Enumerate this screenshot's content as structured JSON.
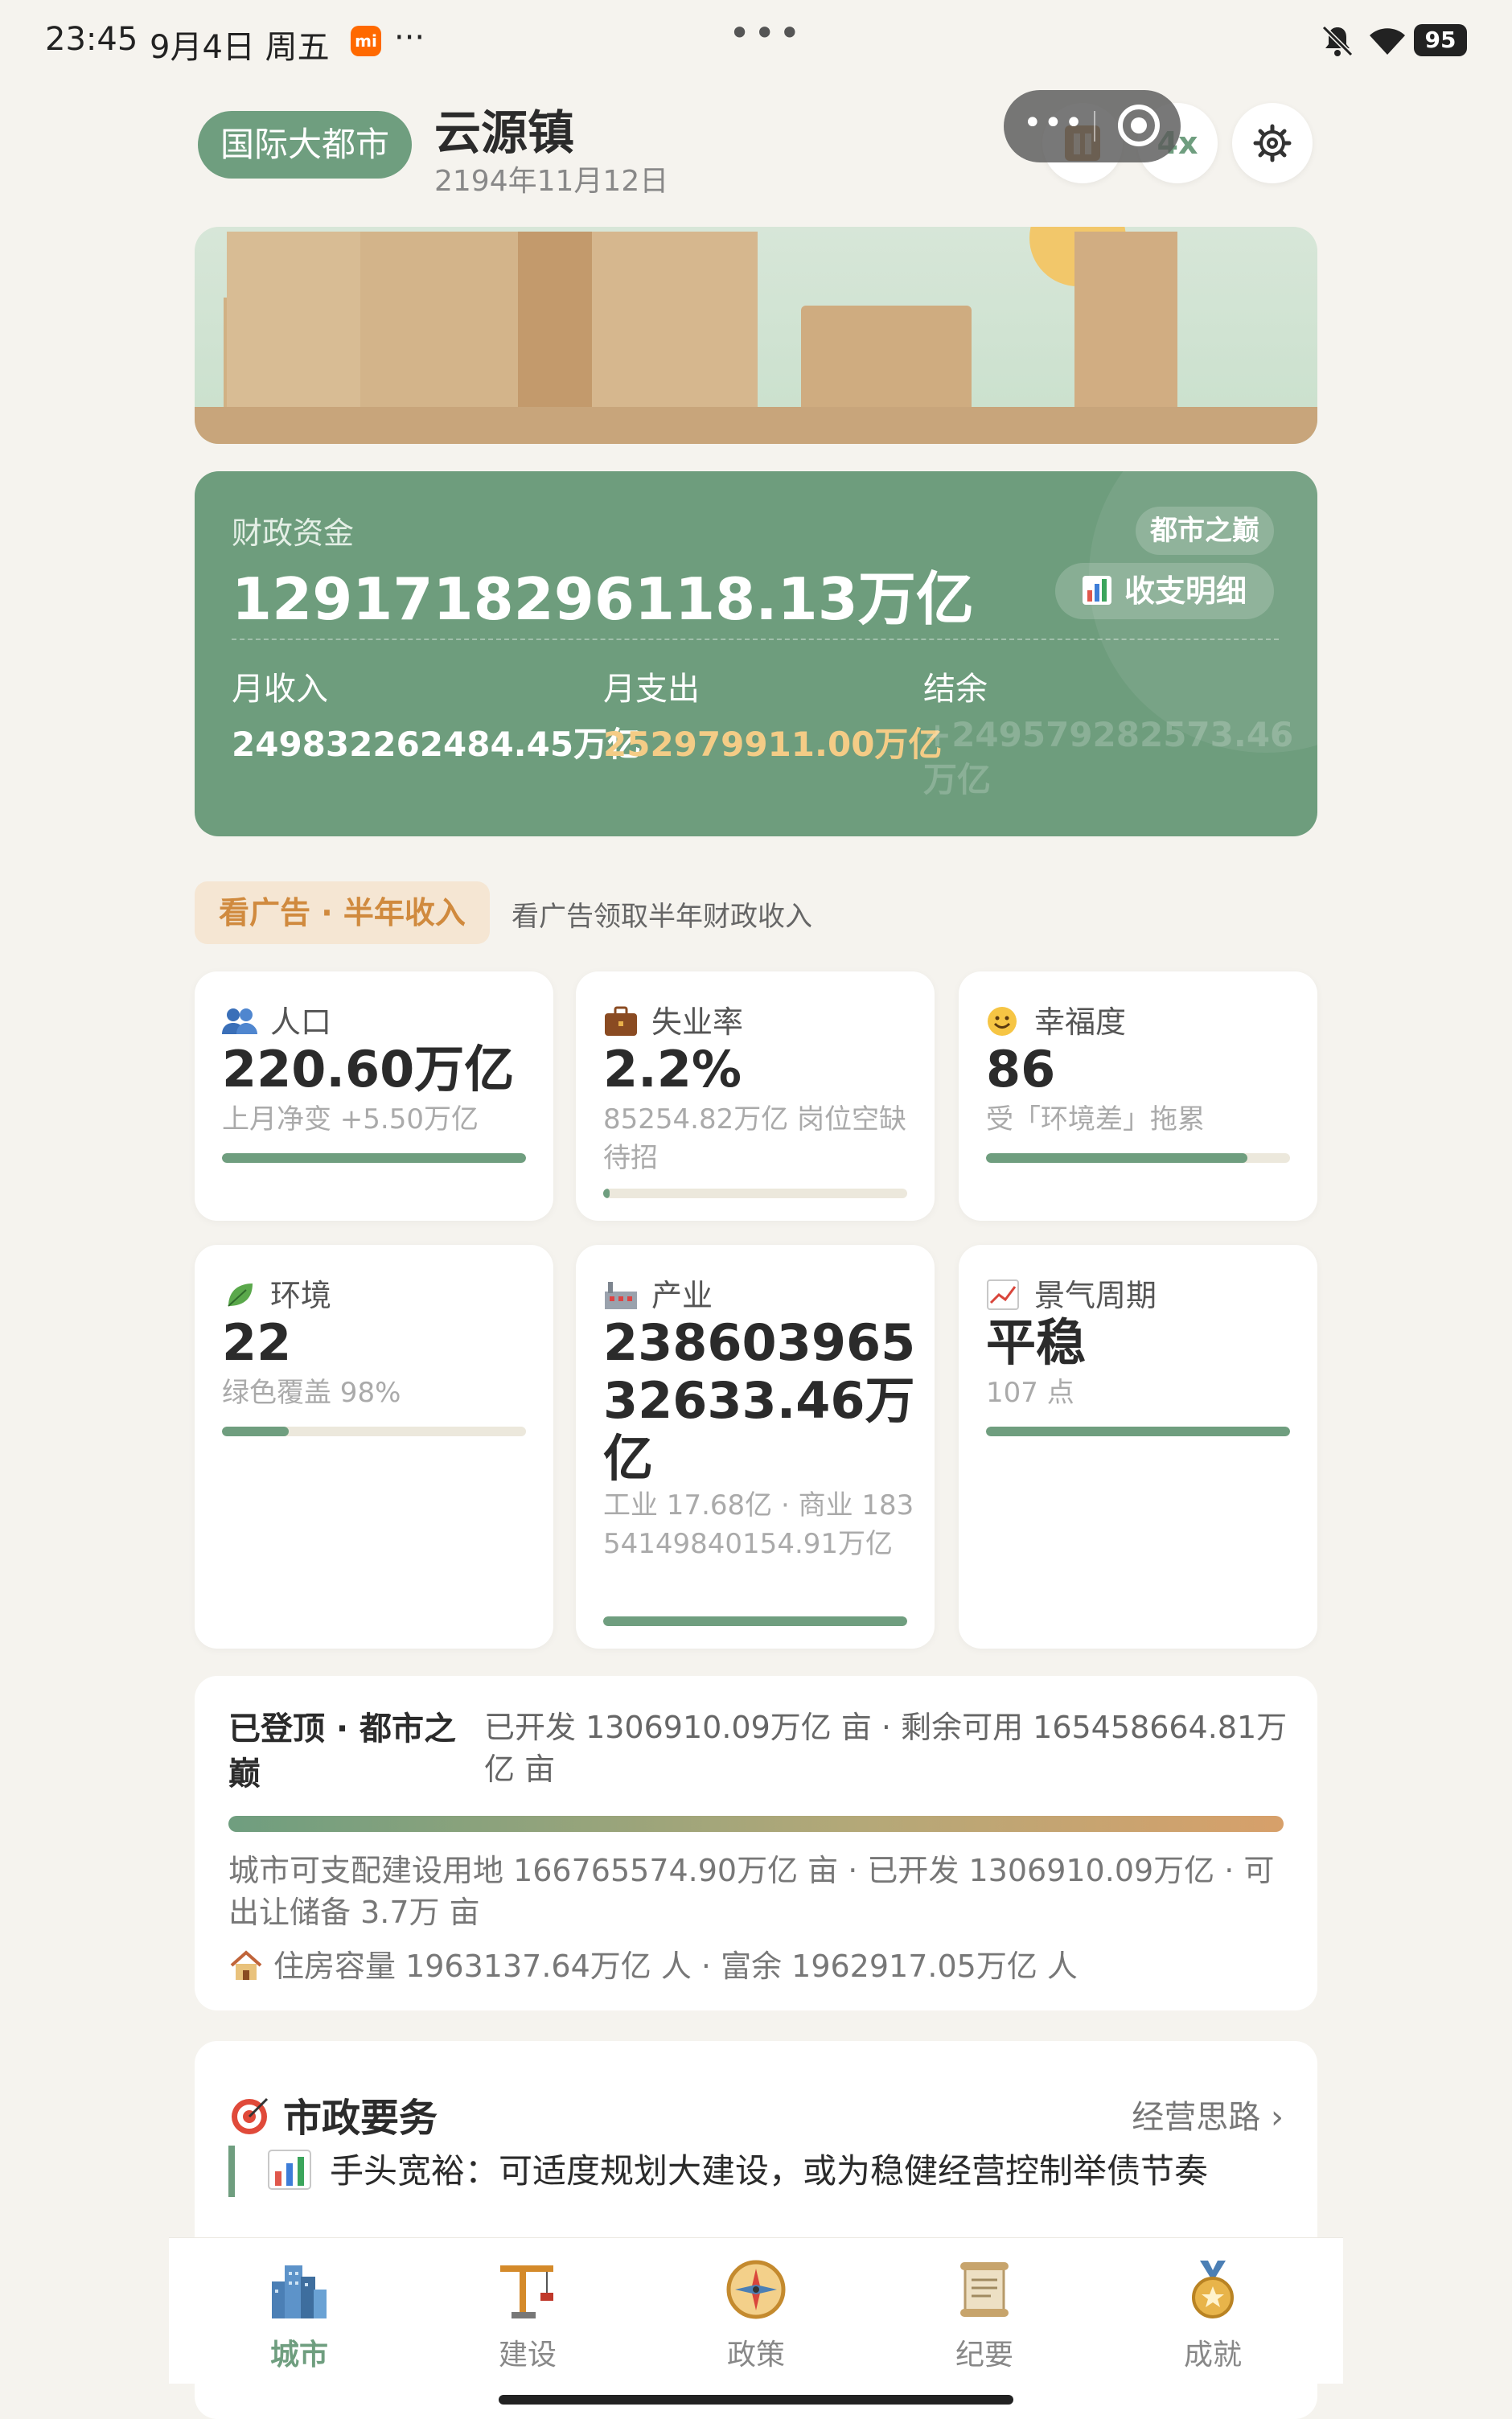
{
  "status_bar": {
    "time": "23:45",
    "date": "9月4日 周五",
    "battery": "95",
    "mi_label": "mi",
    "more_dots": "···",
    "center_dots": "•••"
  },
  "header": {
    "level": "国际大都市",
    "town": "云源镇",
    "date": "2194年11月12日",
    "speed": "4x"
  },
  "finance": {
    "label": "财政资金",
    "amount": "129171829611​8.13万亿",
    "badge": "都市之巅",
    "detail_button": "收支明细",
    "income_label": "月收入",
    "income": "249832262484.45万亿",
    "expense_label": "月支出",
    "expense": "252979911.00万亿",
    "balance_label": "结余",
    "balance": "+249579282573.46万亿"
  },
  "ad": {
    "button": "看广告 · 半年收入",
    "description": "看广告领取半年财政收入"
  },
  "stats": [
    {
      "title": "人口",
      "value": "220.60万亿",
      "sub": "上月净变 +5.50万亿",
      "progress": 1.0
    },
    {
      "title": "失业率",
      "value": "2.2%",
      "sub": "85254.82万亿 岗位空缺待招",
      "progress": 0.02
    },
    {
      "title": "幸福度",
      "value": "86",
      "sub": "受「环境差」拖累",
      "progress": 0.86
    },
    {
      "title": "环境",
      "value": "22",
      "sub": "绿色覆盖 98%",
      "progress": 0.22
    },
    {
      "title": "产业",
      "value": "23860396532633.46万亿",
      "sub": "工业 17.68亿 · 商业 18354149840154.91万亿",
      "progress": 1.0
    },
    {
      "title": "景气周期",
      "value": "平稳",
      "sub": "107 点",
      "progress": 1.0
    }
  ],
  "land": {
    "title": "已登顶 · 都市之巅",
    "developed": "已开发 1306910.09万亿 亩 · 剩余可用 165458664.81万亿 亩",
    "info": "城市可支配建设用地 166765574.90万亿 亩 · 已开发 1306910.09万亿 · 可出让储备 3.7万 亩",
    "housing": "住房容量 1963137.64万亿 人 · 富余 1962917.05万亿 人"
  },
  "civic": {
    "title": "市政要务",
    "link": "经营思路 ›",
    "item": "手头宽裕：可适度规划大建设，或为稳健经营控制举债节奏"
  },
  "tabs": [
    {
      "label": "城市",
      "icon": "city-icon"
    },
    {
      "label": "建设",
      "icon": "crane-icon"
    },
    {
      "label": "政策",
      "icon": "compass-icon"
    },
    {
      "label": "纪要",
      "icon": "scroll-icon"
    },
    {
      "label": "成就",
      "icon": "medal-icon"
    }
  ],
  "colors": {
    "accent": "#6f9e7f",
    "finance_bg": "#6e9d7d",
    "expense": "#f4cc86",
    "ad_bg": "#f5e6d3",
    "ad_text": "#d08a3e"
  }
}
